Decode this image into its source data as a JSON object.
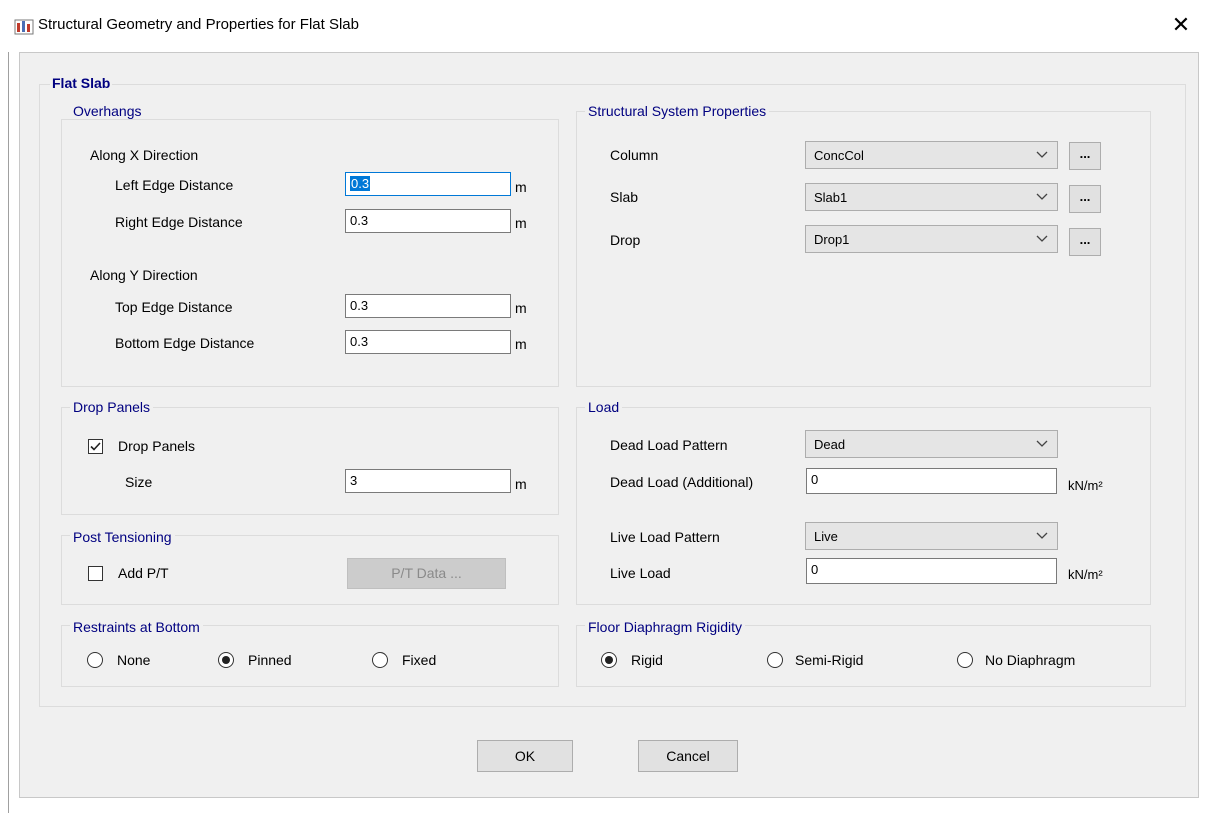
{
  "window": {
    "title": "Structural Geometry and Properties for Flat Slab",
    "close_glyph": "✕"
  },
  "flat_slab": {
    "title": "Flat Slab"
  },
  "overhangs": {
    "title": "Overhangs",
    "along_x": "Along X Direction",
    "left_edge": {
      "label": "Left Edge Distance",
      "value": "0.3",
      "unit": "m"
    },
    "right_edge": {
      "label": "Right Edge Distance",
      "value": "0.3",
      "unit": "m"
    },
    "along_y": "Along Y Direction",
    "top_edge": {
      "label": "Top Edge Distance",
      "value": "0.3",
      "unit": "m"
    },
    "bottom_edge": {
      "label": "Bottom Edge Distance",
      "value": "0.3",
      "unit": "m"
    }
  },
  "drop_panels": {
    "title": "Drop Panels",
    "checkbox_label": "Drop Panels",
    "checked": true,
    "size": {
      "label": "Size",
      "value": "3",
      "unit": "m"
    }
  },
  "post_tensioning": {
    "title": "Post Tensioning",
    "checkbox_label": "Add P/T",
    "checked": false,
    "data_button": "P/T Data ..."
  },
  "restraints": {
    "title": "Restraints at Bottom",
    "options": [
      "None",
      "Pinned",
      "Fixed"
    ],
    "selected": "Pinned"
  },
  "structural_system": {
    "title": "Structural System Properties",
    "column": {
      "label": "Column",
      "value": "ConcCol"
    },
    "slab": {
      "label": "Slab",
      "value": "Slab1"
    },
    "drop": {
      "label": "Drop",
      "value": "Drop1"
    },
    "more_button": "..."
  },
  "load": {
    "title": "Load",
    "dead_pattern": {
      "label": "Dead Load Pattern",
      "value": "Dead"
    },
    "dead_additional": {
      "label": "Dead Load (Additional)",
      "value": "0",
      "unit": "kN/m²"
    },
    "live_pattern": {
      "label": "Live Load Pattern",
      "value": "Live"
    },
    "live_load": {
      "label": "Live Load",
      "value": "0",
      "unit": "kN/m²"
    }
  },
  "diaphragm": {
    "title": "Floor Diaphragm Rigidity",
    "options": [
      "Rigid",
      "Semi-Rigid",
      "No Diaphragm"
    ],
    "selected": "Rigid"
  },
  "buttons": {
    "ok": "OK",
    "cancel": "Cancel"
  },
  "colors": {
    "group_title": "#000080",
    "focus_border": "#0078d7",
    "dialog_bg": "#f0f0f0"
  }
}
